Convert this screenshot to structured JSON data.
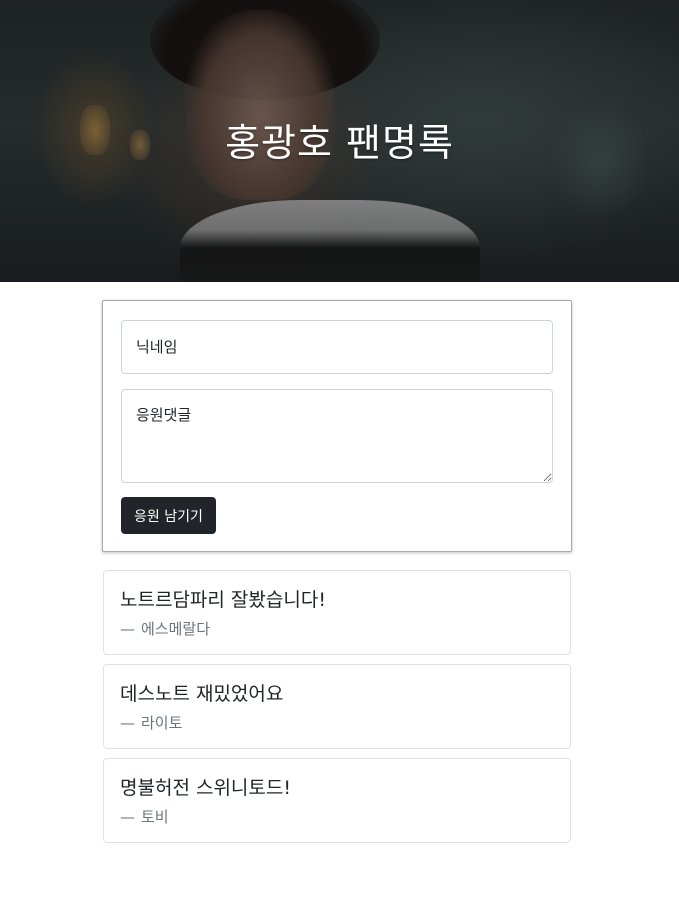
{
  "hero": {
    "title": "홍광호 팬명록"
  },
  "form": {
    "nickname_placeholder": "닉네임",
    "comment_placeholder": "응원댓글",
    "submit_label": "응원 남기기"
  },
  "comments": [
    {
      "text": "노트르담파리 잘봤습니다!",
      "dash": "—",
      "author": "에스메랄다"
    },
    {
      "text": "데스노트 재밌었어요",
      "dash": "—",
      "author": "라이토"
    },
    {
      "text": "명불허전 스위니토드!",
      "dash": "—",
      "author": "토비"
    }
  ],
  "colors": {
    "button_bg": "#212529",
    "author_text": "#6c757d",
    "card_border": "#dee2e6"
  }
}
